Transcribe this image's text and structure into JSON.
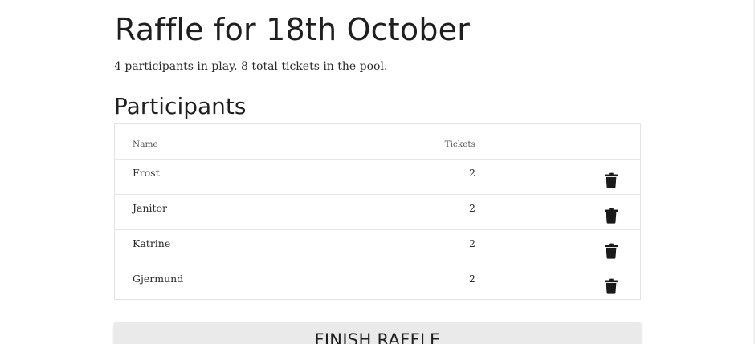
{
  "page": {
    "title": "Raffle for 18th October",
    "summary": "4 participants in play. 8 total tickets in the pool."
  },
  "participants": {
    "heading": "Participants",
    "columns": {
      "name": "Name",
      "tickets": "Tickets"
    },
    "rows": [
      {
        "name": "Frost",
        "tickets": "2"
      },
      {
        "name": "Janitor",
        "tickets": "2"
      },
      {
        "name": "Katrine",
        "tickets": "2"
      },
      {
        "name": "Gjermund",
        "tickets": "2"
      }
    ],
    "row_action_icon": "trash-icon"
  },
  "actions": {
    "finish_label": "FINISH RAFFLE"
  },
  "colors": {
    "text": "#1f1f1f",
    "button_bg": "#eaeaea",
    "border": "#e3e3e3"
  }
}
